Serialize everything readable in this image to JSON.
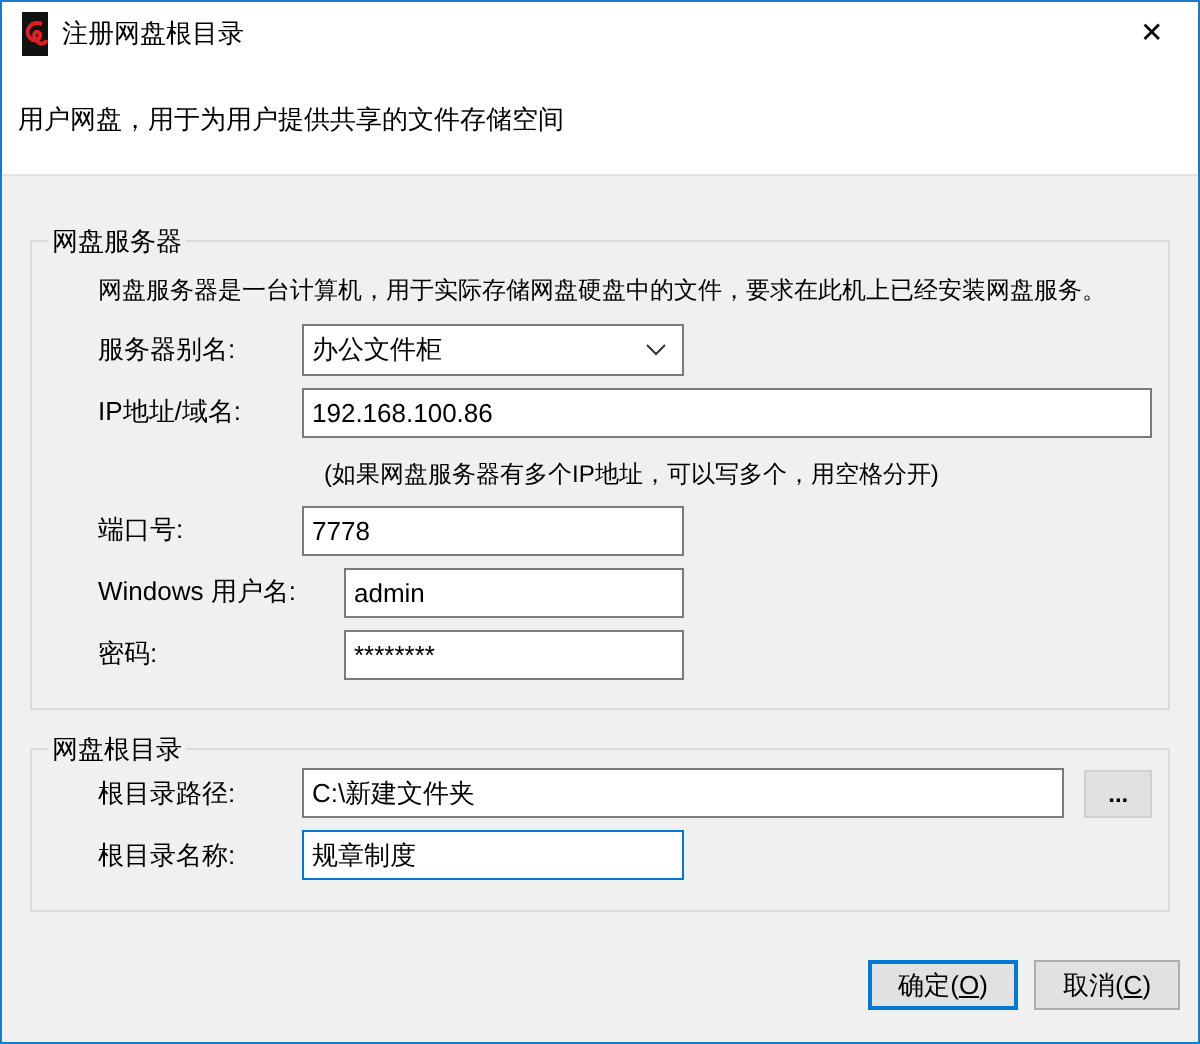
{
  "window": {
    "title": "注册网盘根目录",
    "close": "✕"
  },
  "header": "用户网盘，用于为用户提供共享的文件存储空间",
  "groups": [
    {
      "title": "网盘服务器",
      "rows": [
        {
          "kind": "note",
          "text": "网盘服务器是一台计算机，用于实际存储网盘硬盘中的文件，要求在此机上已经安装网盘服务。"
        },
        {
          "kind": "combo",
          "label": "服务器别名:",
          "value": "办公文件柜",
          "focused": false
        },
        {
          "kind": "text",
          "label": "IP地址/域名:",
          "value": "192.168.100.86",
          "focused": false
        },
        {
          "kind": "hint",
          "text": "(如果网盘服务器有多个IP地址，可以写多个，用空格分开)"
        },
        {
          "kind": "text",
          "label": "端口号:",
          "value": "7778",
          "focused": false
        },
        {
          "kind": "text",
          "label": "Windows 用户名:",
          "value": "admin",
          "focused": false
        },
        {
          "kind": "password",
          "label": "密码:",
          "value": "********",
          "focused": false
        }
      ]
    },
    {
      "title": "网盘根目录",
      "rows": [
        {
          "kind": "browse",
          "label": "根目录路径:",
          "value": "C:\\新建文件夹",
          "button": "...",
          "focused": false
        },
        {
          "kind": "text",
          "label": "根目录名称:",
          "value": "规章制度",
          "focused": true
        }
      ]
    }
  ],
  "buttons": [
    {
      "label": "确定(O)",
      "default": true
    },
    {
      "label": "取消(C)",
      "default": false
    }
  ]
}
